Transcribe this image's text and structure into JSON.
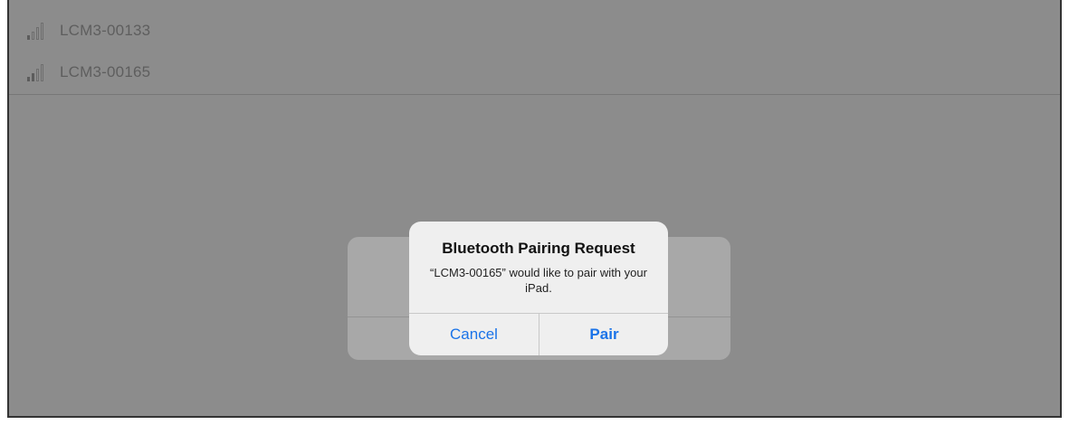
{
  "devices": [
    {
      "name": "LCM3-00133",
      "signal_bars": 1,
      "signal_max": 4,
      "icon": "signal-strength-icon"
    },
    {
      "name": "LCM3-00165",
      "signal_bars": 2,
      "signal_max": 4,
      "icon": "signal-strength-icon"
    }
  ],
  "alert": {
    "title": "Bluetooth Pairing Request",
    "message": "“LCM3-00165” would like to pair with your iPad.",
    "cancel_label": "Cancel",
    "pair_label": "Pair"
  },
  "colors": {
    "overlay": "#8c8c8c",
    "alert_background": "#efefef",
    "button_text": "#1a73e8"
  }
}
